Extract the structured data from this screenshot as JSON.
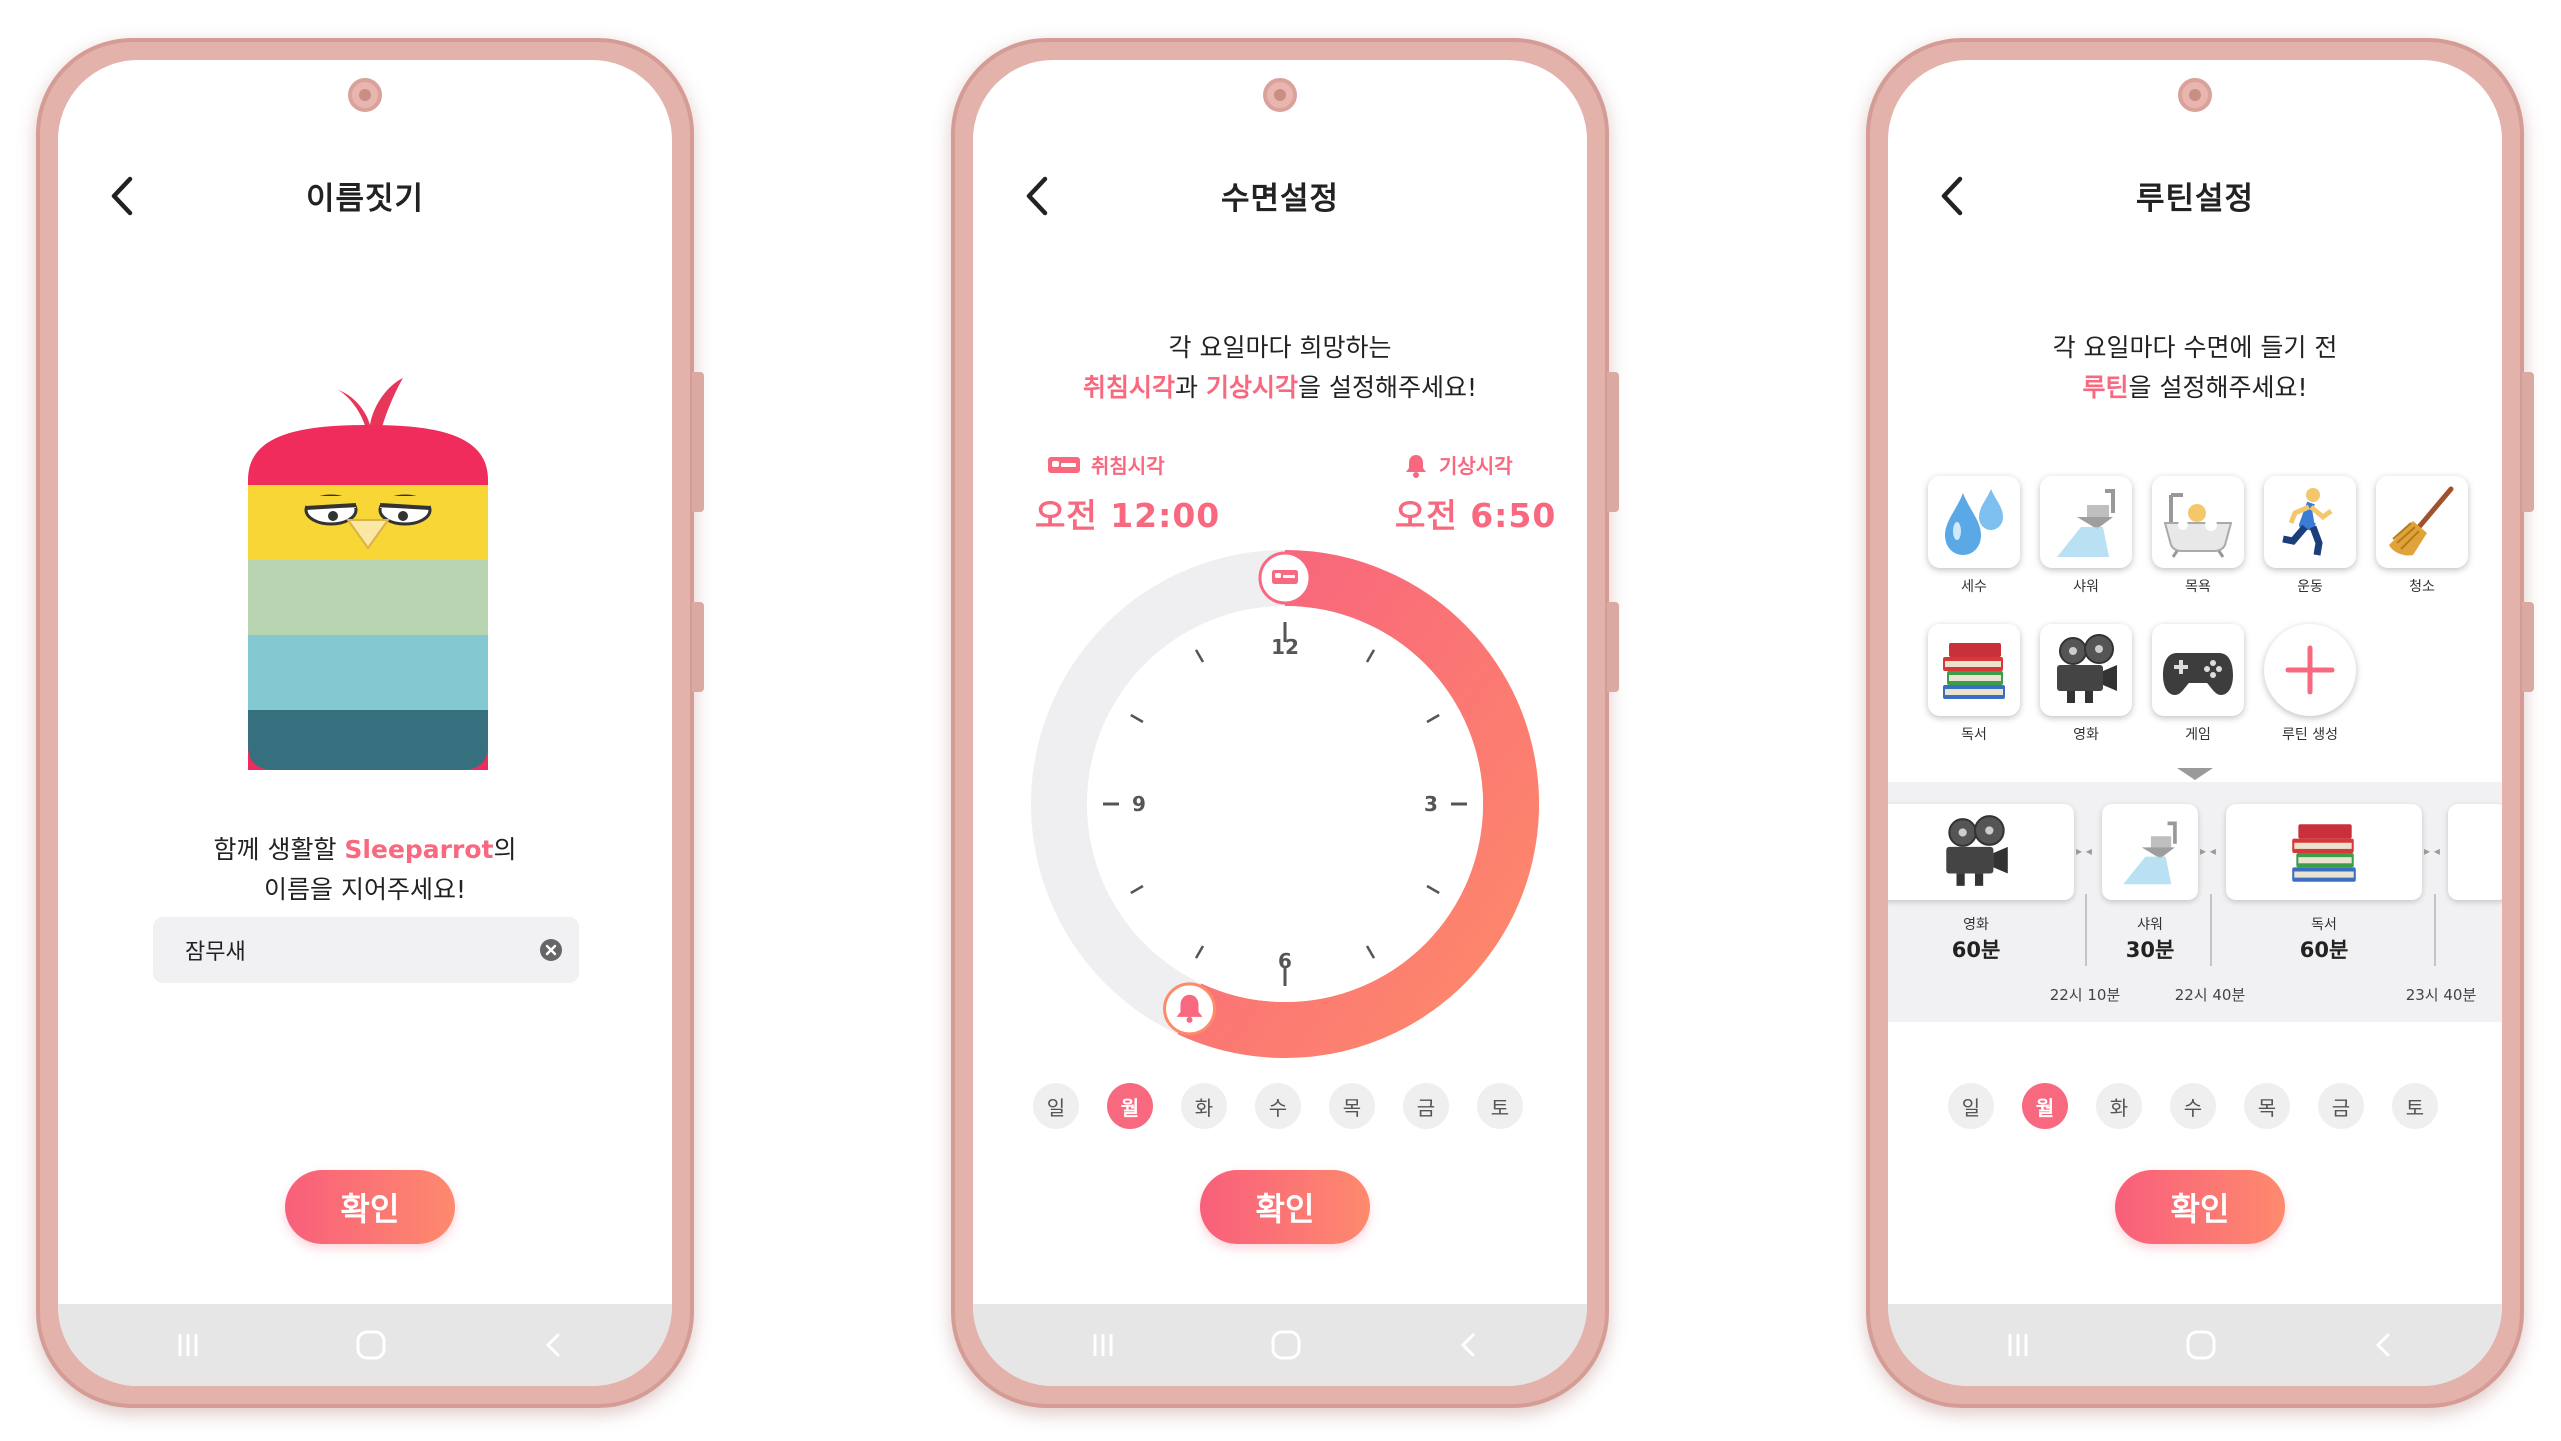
{
  "nav": {
    "recent_glyph": "|||",
    "home_glyph": "○",
    "back_glyph": "‹"
  },
  "phone1": {
    "title": "이름짓기",
    "prompt_line1_pre": "함께 생활할 ",
    "prompt_brand": "Sleeparrot",
    "prompt_line1_post": "의",
    "prompt_line2": "이름을 지어주세요!",
    "name_value": "잠무새",
    "confirm_label": "확인"
  },
  "phone2": {
    "title": "수면설정",
    "instr_line1": "각 요일마다 희망하는",
    "instr_bedtime_word": "취침시각",
    "instr_conj": "과 ",
    "instr_wake_word": "기상시각",
    "instr_tail": "을 설정해주세요!",
    "bedtime_label": "취침시각",
    "bedtime_value": "오전 12:00",
    "wake_label": "기상시각",
    "wake_value": "오전 6:50",
    "clock": {
      "bed_hour": 0.0,
      "wake_hour": 6.833,
      "ticks": [
        "12",
        "3",
        "6",
        "9"
      ]
    },
    "days": [
      "일",
      "월",
      "화",
      "수",
      "목",
      "금",
      "토"
    ],
    "selected_day": "월",
    "confirm_label": "확인"
  },
  "phone3": {
    "title": "루틴설정",
    "instr_line1": "각 요일마다 수면에 들기 전",
    "instr_word": "루틴",
    "instr_tail": "을 설정해주세요!",
    "routines": [
      {
        "label": "세수",
        "icon": "sweat-droplets-icon"
      },
      {
        "label": "샤워",
        "icon": "shower-icon"
      },
      {
        "label": "목욕",
        "icon": "bath-icon"
      },
      {
        "label": "운동",
        "icon": "running-icon"
      },
      {
        "label": "청소",
        "icon": "broom-icon"
      },
      {
        "label": "독서",
        "icon": "books-icon"
      },
      {
        "label": "영화",
        "icon": "film-projector-icon"
      },
      {
        "label": "게임",
        "icon": "game-controller-icon"
      }
    ],
    "add_label": "루틴 생성",
    "timeline": [
      {
        "name": "영화",
        "duration": "60분"
      },
      {
        "name": "샤워",
        "duration": "30분"
      },
      {
        "name": "독서",
        "duration": "60분"
      }
    ],
    "timeline_times": [
      "22시 10분",
      "22시 40분",
      "23시 40분"
    ],
    "days": [
      "일",
      "월",
      "화",
      "수",
      "목",
      "금",
      "토"
    ],
    "selected_day": "월",
    "confirm_label": "확인"
  }
}
